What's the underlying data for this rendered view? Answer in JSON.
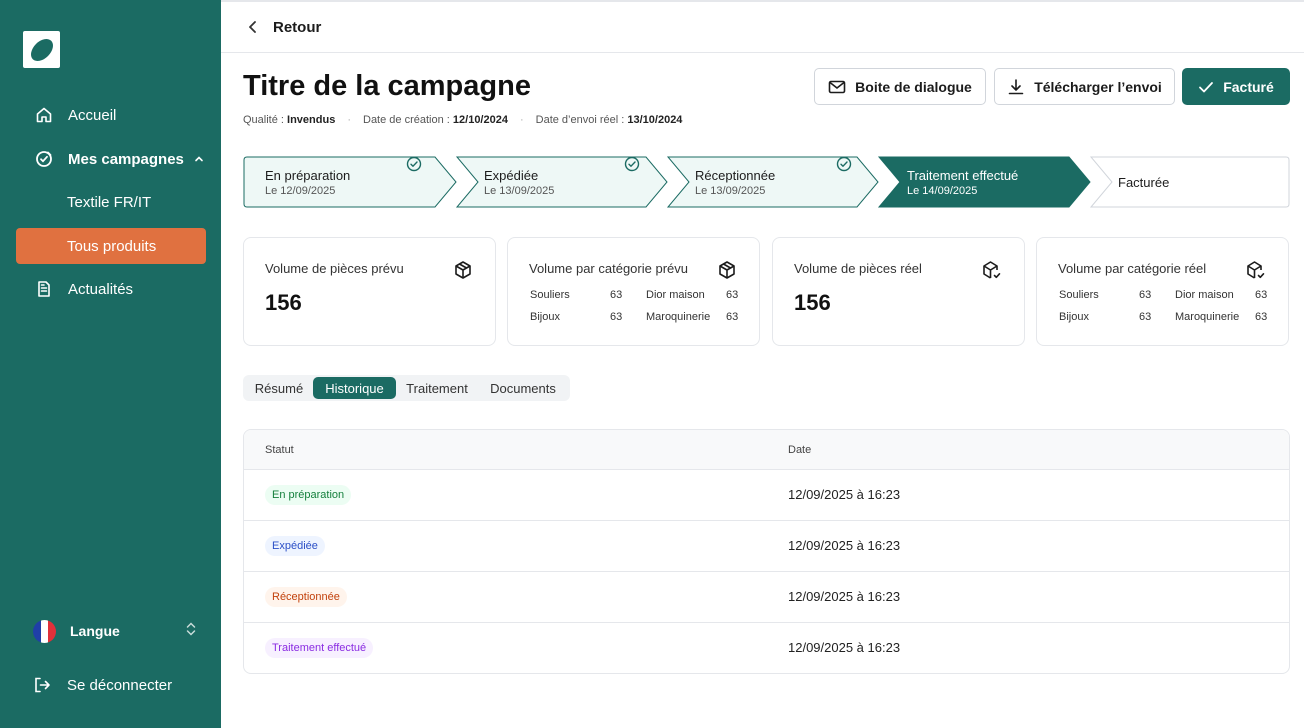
{
  "sidebar": {
    "items": [
      {
        "label": "Accueil",
        "icon": "home-icon"
      },
      {
        "label": "Mes campagnes",
        "icon": "campaign-icon"
      },
      {
        "label": "Textile FR/IT"
      },
      {
        "label": "Tous produits"
      },
      {
        "label": "Actualités",
        "icon": "document-icon"
      }
    ],
    "language_label": "Langue",
    "logout_label": "Se déconnecter"
  },
  "topbar": {
    "back_label": "Retour"
  },
  "header": {
    "title": "Titre de la campagne",
    "quality_label": "Qualité : ",
    "quality_value": "Invendus",
    "created_label": "Date de création : ",
    "created_value": "12/10/2024",
    "sent_label": "Date d’envoi réel : ",
    "sent_value": "13/10/2024"
  },
  "actions": {
    "dialog": "Boite de dialogue",
    "download": "Télécharger l’envoi",
    "invoiced": "Facturé"
  },
  "steps": [
    {
      "title": "En préparation",
      "date": "Le 12/09/2025",
      "done": true
    },
    {
      "title": "Expédiée",
      "date": "Le 13/09/2025",
      "done": true
    },
    {
      "title": "Réceptionnée",
      "date": "Le 13/09/2025",
      "done": true
    },
    {
      "title": "Traitement effectué",
      "date": "Le 14/09/2025",
      "current": true
    },
    {
      "title": "Facturée",
      "date": ""
    }
  ],
  "cards": [
    {
      "title": "Volume de pièces prévu",
      "value": "156"
    },
    {
      "title": "Volume par catégorie prévu",
      "categories": [
        {
          "name": "Souliers",
          "value": "63"
        },
        {
          "name": "Dior maison",
          "value": "63"
        },
        {
          "name": "Bijoux",
          "value": "63"
        },
        {
          "name": "Maroquinerie",
          "value": "63"
        }
      ]
    },
    {
      "title": "Volume de pièces réel",
      "value": "156"
    },
    {
      "title": "Volume par catégorie réel",
      "categories": [
        {
          "name": "Souliers",
          "value": "63"
        },
        {
          "name": "Dior maison",
          "value": "63"
        },
        {
          "name": "Bijoux",
          "value": "63"
        },
        {
          "name": "Maroquinerie",
          "value": "63"
        }
      ]
    }
  ],
  "tabs": [
    "Résumé",
    "Historique",
    "Traitement",
    "Documents"
  ],
  "table": {
    "headers": [
      "Statut",
      "Date"
    ],
    "rows": [
      {
        "status": "En préparation",
        "date": "12/09/2025 à 16:23"
      },
      {
        "status": "Expédiée",
        "date": "12/09/2025 à 16:23"
      },
      {
        "status": "Réceptionnée",
        "date": "12/09/2025 à 16:23"
      },
      {
        "status": "Traitement effectué",
        "date": "12/09/2025 à 16:23"
      }
    ]
  },
  "colors": {
    "brand": "#1b6b63",
    "accent": "#e07140",
    "step_done_bg": "#eef8f6",
    "badge_green_bg": "#ecfdf3",
    "badge_green_text": "#15803d",
    "badge_blue_bg": "#eef4ff",
    "badge_blue_text": "#2b4fc7",
    "badge_orange_bg": "#fff4ec",
    "badge_orange_text": "#c2410c",
    "badge_purple_bg": "#f7f0ff",
    "badge_purple_text": "#8a2be2"
  }
}
